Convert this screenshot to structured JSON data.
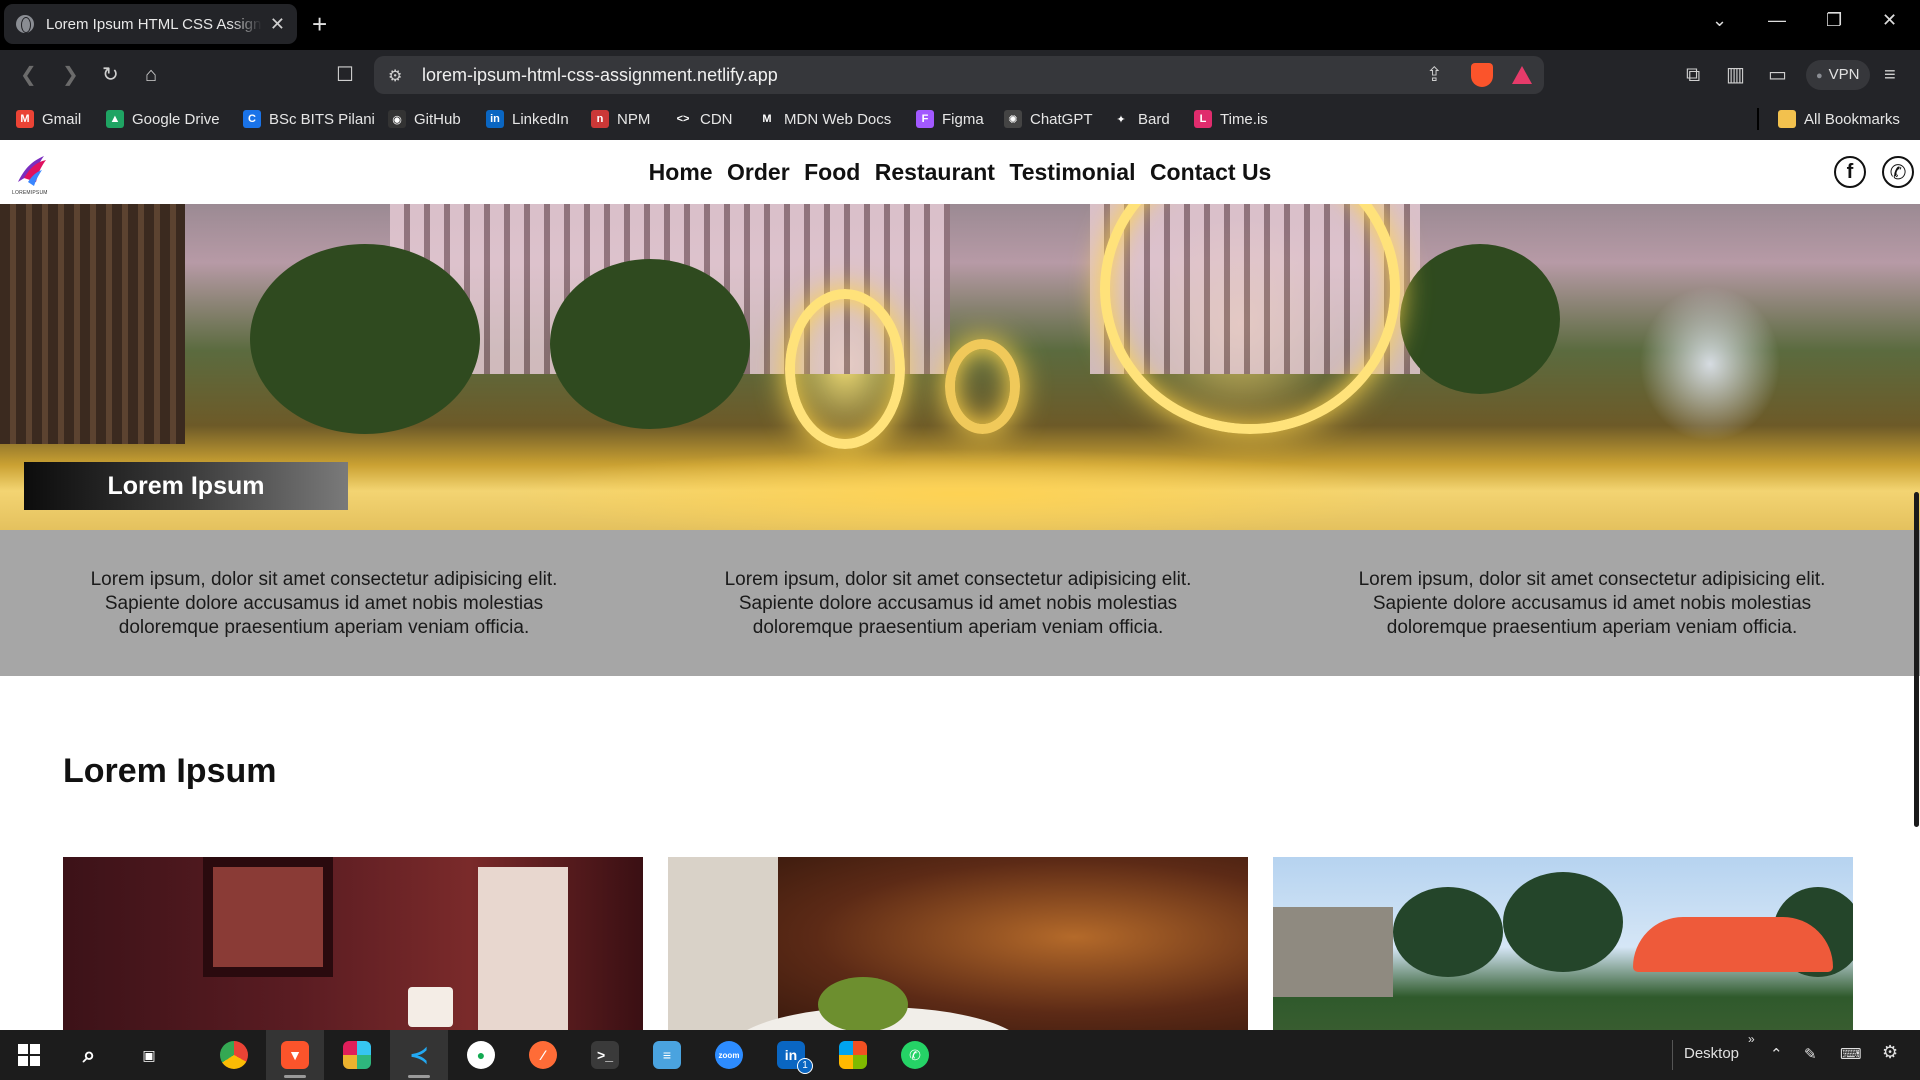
{
  "browser": {
    "tab_title": "Lorem Ipsum HTML CSS Assignment",
    "tab_close": "✕",
    "new_tab": "+",
    "url": "lorem-ipsum-html-css-assignment.netlify.app",
    "vpn_label": "VPN",
    "bookmarks": [
      {
        "label": "Gmail",
        "icon": "gmail-icon",
        "color": "#ea4335",
        "glyph": "M"
      },
      {
        "label": "Google Drive",
        "icon": "google-drive-icon",
        "color": "#1fa463",
        "glyph": "▲"
      },
      {
        "label": "BSc BITS Pilani",
        "icon": "bits-pilani-icon",
        "color": "#1a73e8",
        "glyph": "C"
      },
      {
        "label": "GitHub",
        "icon": "github-icon",
        "color": "#333333",
        "glyph": "◉"
      },
      {
        "label": "LinkedIn",
        "icon": "linkedin-icon",
        "color": "#0a66c2",
        "glyph": "in"
      },
      {
        "label": "NPM",
        "icon": "npm-icon",
        "color": "#cb3837",
        "glyph": "n"
      },
      {
        "label": "CDN",
        "icon": "cdn-icon",
        "color": "#232428",
        "glyph": "<>"
      },
      {
        "label": "MDN Web Docs",
        "icon": "mdn-icon",
        "color": "#232428",
        "glyph": "M"
      },
      {
        "label": "Figma",
        "icon": "figma-icon",
        "color": "#a259ff",
        "glyph": "F"
      },
      {
        "label": "ChatGPT",
        "icon": "chatgpt-icon",
        "color": "#444444",
        "glyph": "✺"
      },
      {
        "label": "Bard",
        "icon": "bard-icon",
        "color": "#232428",
        "glyph": "✦"
      },
      {
        "label": "Time.is",
        "icon": "timeis-icon",
        "color": "#e02c6d",
        "glyph": "L"
      }
    ],
    "all_bookmarks": "All Bookmarks"
  },
  "site": {
    "logo_text": "LOREMIPSUM",
    "nav": [
      "Home",
      "Order",
      "Food",
      "Restaurant",
      "Testimonial",
      "Contact Us"
    ],
    "social": {
      "facebook": "f",
      "whatsapp": "✆"
    },
    "hero_caption": "Lorem Ipsum",
    "features": [
      "Lorem ipsum, dolor sit amet consectetur adipisicing elit. Sapiente dolore accusamus id amet nobis molestias doloremque praesentium aperiam veniam officia.",
      "Lorem ipsum, dolor sit amet consectetur adipisicing elit. Sapiente dolore accusamus id amet nobis molestias doloremque praesentium aperiam veniam officia.",
      "Lorem ipsum, dolor sit amet consectetur adipisicing elit. Sapiente dolore accusamus id amet nobis molestias doloremque praesentium aperiam veniam officia."
    ],
    "section_title": "Lorem Ipsum"
  },
  "taskbar": {
    "desktop_label": "Desktop",
    "linkedin_badge": "1"
  }
}
